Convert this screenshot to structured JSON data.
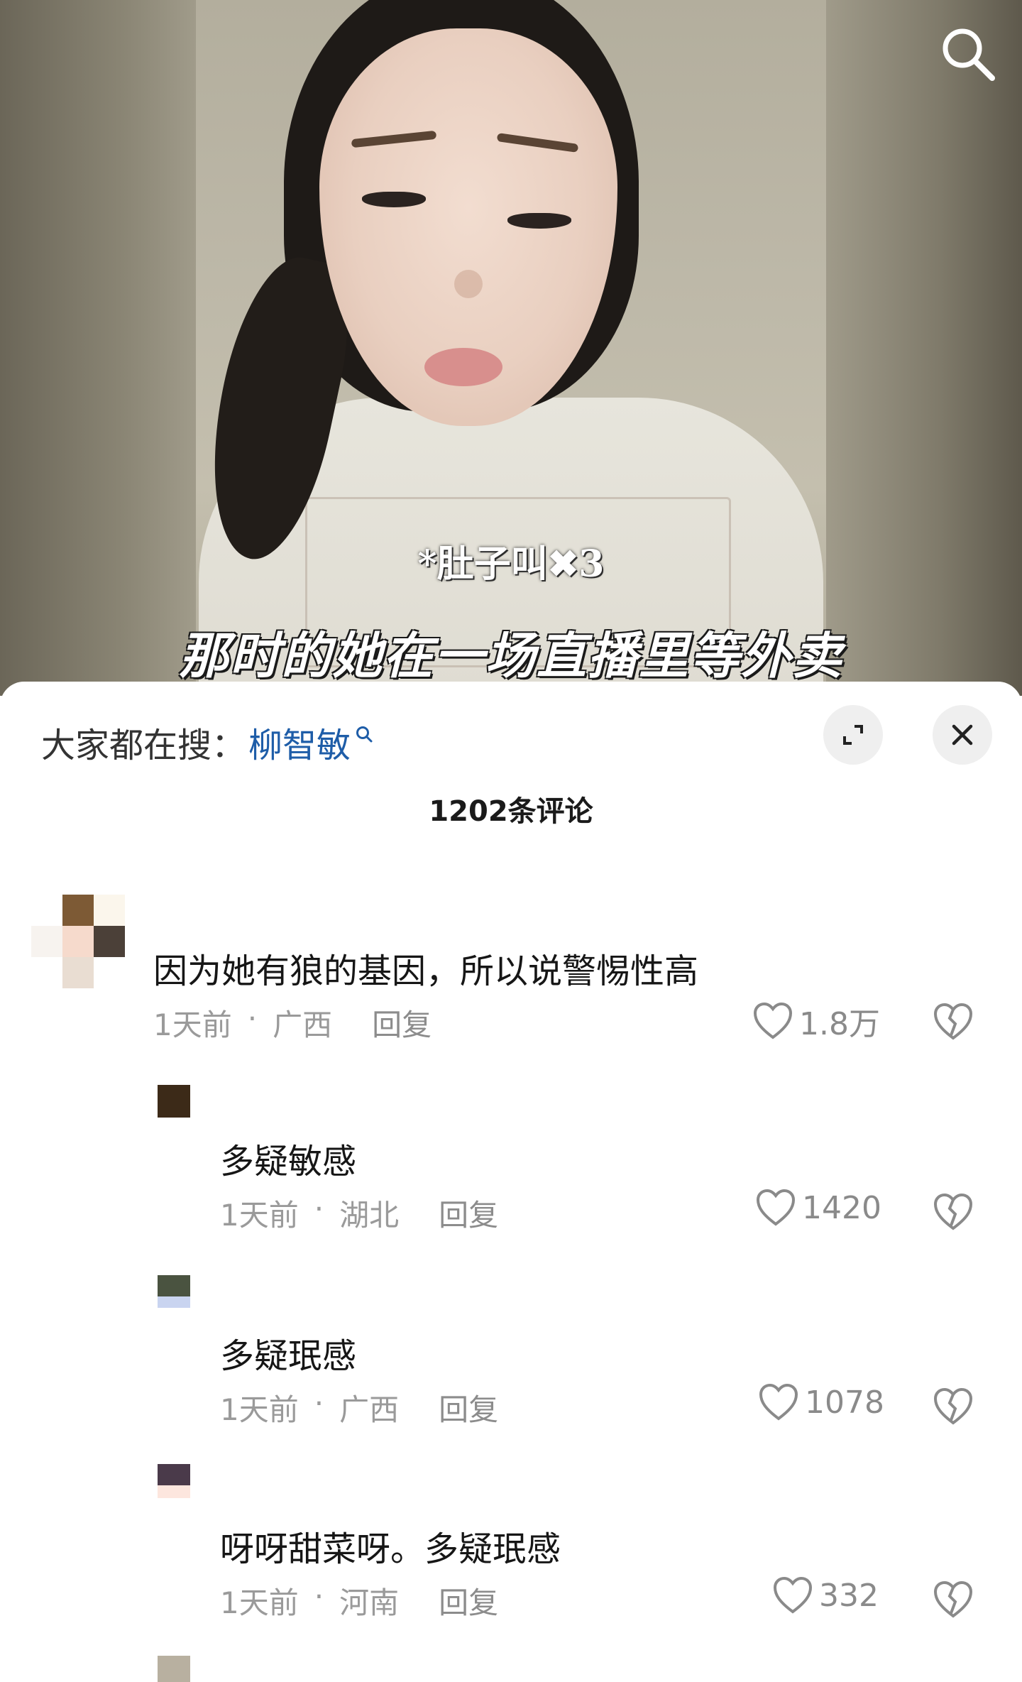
{
  "video": {
    "caption_small": "*肚子叫✖3",
    "caption_big": "那时的她在一场直播里等外卖"
  },
  "sheet": {
    "hot_search_prefix": "大家都在搜：",
    "hot_search_keyword": "柳智敏",
    "comment_count_title": "1202条评论"
  },
  "comments": [
    {
      "text": "因为她有狼的基因，所以说警惕性高",
      "time": "1天前",
      "dot": "·",
      "location": "广西",
      "reply": "回复",
      "likes": "1.8万"
    },
    {
      "text": "多疑敏感",
      "time": "1天前",
      "dot": "·",
      "location": "湖北",
      "reply": "回复",
      "likes": "1420"
    },
    {
      "text": "多疑珉感",
      "time": "1天前",
      "dot": "·",
      "location": "广西",
      "reply": "回复",
      "likes": "1078"
    },
    {
      "text": "呀呀甜菜呀。多疑珉感",
      "time": "1天前",
      "dot": "·",
      "location": "河南",
      "reply": "回复",
      "likes": "332"
    }
  ],
  "colors": {
    "keyword": "#1e5da8",
    "meta": "#9a9a9a",
    "button_bg": "#efefef"
  },
  "icons": {
    "video_search": "search-icon",
    "keyword_search": "small-search-icon",
    "expand": "expand-icon",
    "close": "close-icon",
    "like": "heart-icon",
    "dislike": "broken-heart-icon"
  }
}
